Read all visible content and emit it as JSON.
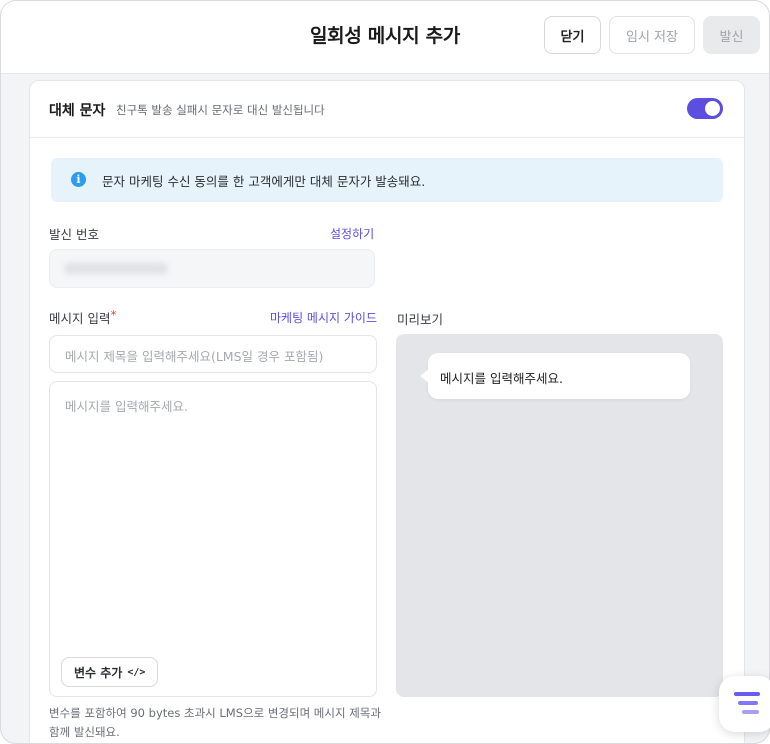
{
  "header": {
    "title": "일회성 메시지 추가",
    "close_label": "닫기",
    "temp_save_label": "임시 저장",
    "send_label": "발신"
  },
  "fallback": {
    "title": "대체 문자",
    "description": "친구톡 발송 실패시 문자로 대신 발신됩니다",
    "toggle_on": true,
    "accent_color": "#5b4ee0"
  },
  "notice": {
    "icon": "info-icon",
    "text": "문자 마케팅 수신 동의를 한 고객에게만 대체 문자가 발송돼요."
  },
  "sender": {
    "label": "발신 번호",
    "link": "설정하기"
  },
  "message": {
    "label": "메시지 입력",
    "required_mark": "*",
    "guide_link": "마케팅 메시지 가이드",
    "subject_placeholder": "메시지 제목을 입력해주세요(LMS일 경우 포함됨)",
    "body_placeholder": "메시지를 입력해주세요.",
    "variable_button": "변수 추가",
    "variable_icon": "</>",
    "hint": "변수를 포함하여 90 bytes 초과시 LMS으로 변경되며 메시지 제목과 함께 발신돼요."
  },
  "preview": {
    "label": "미리보기",
    "bubble_text": "메시지를 입력해주세요."
  }
}
